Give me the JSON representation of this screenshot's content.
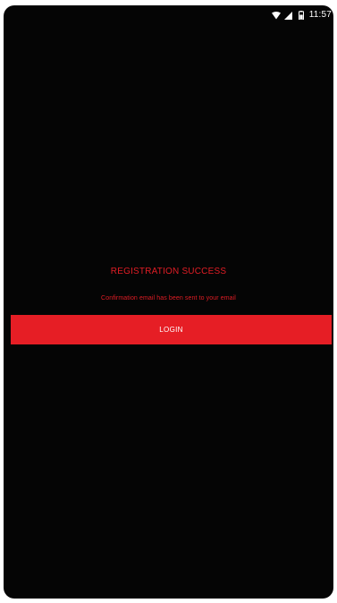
{
  "status_bar": {
    "time": "11:57",
    "icons": [
      "wifi-icon",
      "signal-icon",
      "battery-icon"
    ]
  },
  "screen": {
    "title": "REGISTRATION SUCCESS",
    "message": "Confirmation email has been sent to your email",
    "login_button_label": "LOGIN"
  },
  "colors": {
    "background": "#050505",
    "accent": "#e61e25",
    "text_on_accent": "#ffffff"
  }
}
